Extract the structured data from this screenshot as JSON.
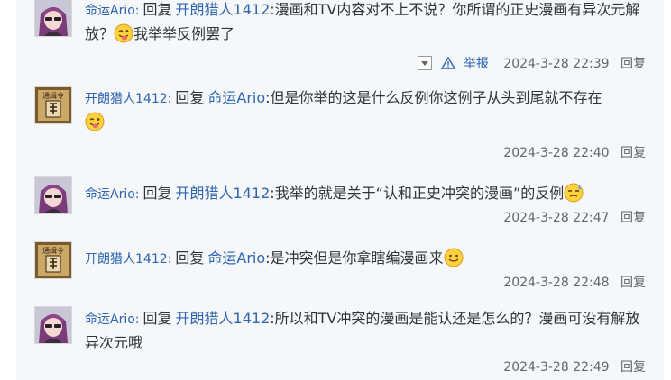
{
  "replies": [
    {
      "user": "命运Ario",
      "reply_word": "回复",
      "target": "开朗猎人1412",
      "text_a": ":漫画和TV内容对不上不说？你所谓的正史漫画有异次元解放？",
      "text_b": "我举举反例罢了",
      "report": "举报",
      "time": "2024-3-28 22:39",
      "reply_btn": "回复"
    },
    {
      "user": "开朗猎人1412",
      "reply_word": "回复",
      "target": "命运Ario",
      "text_a": ":但是你举的这是什么反例你这例子从头到尾就不存在",
      "time": "2024-3-28 22:40",
      "reply_btn": "回复"
    },
    {
      "user": "命运Ario",
      "reply_word": "回复",
      "target": "开朗猎人1412",
      "text_a": ":我举的就是关于“认和正史冲突的漫画”的反例",
      "time": "2024-3-28 22:47",
      "reply_btn": "回复"
    },
    {
      "user": "开朗猎人1412",
      "reply_word": "回复",
      "target": "命运Ario",
      "text_a": ":是冲突但是你拿瞎编漫画来",
      "time": "2024-3-28 22:48",
      "reply_btn": "回复"
    },
    {
      "user": "命运Ario",
      "reply_word": "回复",
      "target": "开朗猎人1412",
      "text_a": ":所以和TV冲突的漫画是能认还是怎么的？漫画可没有解放异次元哦",
      "time": "2024-3-28 22:49",
      "reply_btn": "回复"
    }
  ],
  "icons": {
    "avatar_anime": "anime-avatar-icon",
    "avatar_doc": "notice-avatar-icon",
    "tongue": "tongue-emoji-icon",
    "sweat": "sweat-emoji-icon",
    "smile": "smile-emoji-icon",
    "warning": "warning-icon"
  },
  "colors": {
    "link": "#2d64b3",
    "panel": "#f5f7fa",
    "meta": "#666666"
  }
}
